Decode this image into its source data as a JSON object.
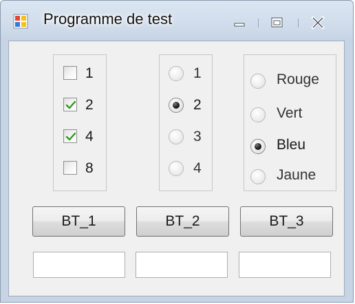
{
  "window": {
    "title": "Programme de test",
    "icons": {
      "app": "app-icon",
      "minimize": "minimize-icon",
      "maximize": "maximize-icon",
      "close": "close-icon"
    }
  },
  "checkboxes": [
    {
      "label": "1",
      "checked": false
    },
    {
      "label": "2",
      "checked": true
    },
    {
      "label": "4",
      "checked": true
    },
    {
      "label": "8",
      "checked": false
    }
  ],
  "radios_numbers": [
    {
      "label": "1",
      "selected": false
    },
    {
      "label": "2",
      "selected": true
    },
    {
      "label": "3",
      "selected": false
    },
    {
      "label": "4",
      "selected": false
    }
  ],
  "radios_colors": [
    {
      "label": "Rouge",
      "selected": false
    },
    {
      "label": "Vert",
      "selected": false
    },
    {
      "label": "Bleu",
      "selected": true
    },
    {
      "label": "Jaune",
      "selected": false
    }
  ],
  "buttons": [
    {
      "label": "BT_1"
    },
    {
      "label": "BT_2"
    },
    {
      "label": "BT_3"
    }
  ],
  "textboxes": [
    {
      "value": ""
    },
    {
      "value": ""
    },
    {
      "value": ""
    }
  ],
  "colors": {
    "check": "#2f9a1f",
    "accent_border": "#8a99ad"
  }
}
